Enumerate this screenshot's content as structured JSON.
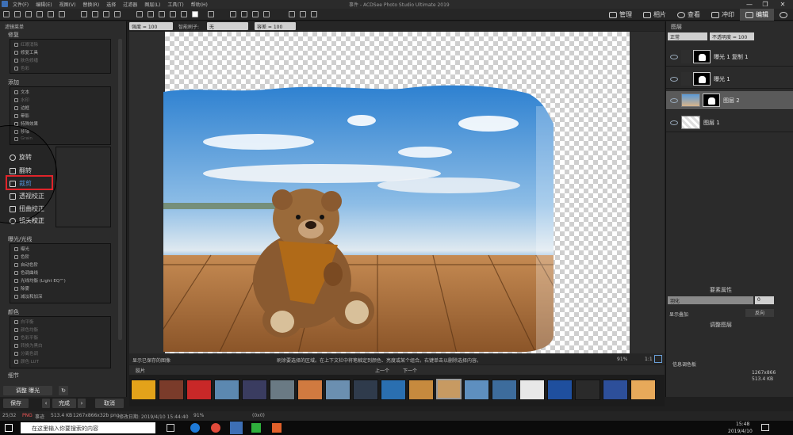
{
  "app": {
    "title": "事件 - ACDSee Photo Studio Ultimate 2019",
    "menus": [
      "文件(F)",
      "编辑(E)",
      "视图(V)",
      "替换(R)",
      "选择",
      "过滤器",
      "图层(L)",
      "工具(T)",
      "帮助(H)"
    ],
    "window_buttons": [
      "—",
      "❐",
      "✕"
    ]
  },
  "modes": [
    {
      "label": "管理",
      "active": false
    },
    {
      "label": "相片",
      "active": false
    },
    {
      "label": "查看",
      "active": false
    },
    {
      "label": "冲印",
      "active": false
    },
    {
      "label": "编辑",
      "active": true
    }
  ],
  "options": {
    "fields": [
      "强度 = 100",
      "智能刷子:",
      "无",
      "容差 = 100"
    ]
  },
  "left_panel": {
    "title": "滤镜菜单",
    "sections": [
      {
        "header": "修复",
        "items": [
          "红眼消除",
          "修复工具",
          "肤色修缮",
          "色彩"
        ]
      },
      {
        "header": "添加",
        "items": [
          "文本",
          "水印",
          "边框",
          "晕影",
          "特殊效果",
          "移轴",
          "Grain"
        ]
      },
      {
        "header": "几何形状",
        "items": [
          "旋转",
          "翻转",
          "裁剪",
          "透视校正",
          "扭曲校正",
          "镜头校正"
        ]
      },
      {
        "header": "曝光/光线",
        "items": [
          "曝光",
          "色阶",
          "自动色阶",
          "色调曲线",
          "光线均衡 (Light EQ™)",
          "除雾",
          "减淡和加深"
        ]
      },
      {
        "header": "颜色",
        "items": [
          "白平衡",
          "颜色均衡",
          "色彩平衡",
          "转换为黑白",
          "分离色调",
          "颜色 LUT"
        ]
      },
      {
        "header": "细节",
        "items": []
      }
    ],
    "adjust_label": "调整 曝光",
    "save_label": "保存",
    "done_label": "完成",
    "cancel_label": "取消"
  },
  "canvas": {
    "status_left": "显示已保存的图像",
    "status_hint": "刷涂要选择的区域。在上下文栏中将笔触定到颜色、亮度或某个组合。右键单击以删除选择内容。",
    "zoom": "91%",
    "ratio": "1:1"
  },
  "filmstrip": {
    "label": "胶片",
    "prev": "上一个",
    "next": "下一个",
    "thumbs": [
      "#e3a21a",
      "#7a3b2a",
      "#c82828",
      "#5c88b0",
      "#3a3c60",
      "#6a7a84",
      "#d07a40",
      "#6b8fb0",
      "#2f3b4c",
      "#2a6fb0",
      "#c68a3e",
      "#c79a62",
      "#5e8fbf",
      "#3d6c9c",
      "#e8e8e8",
      "#1f4f9e",
      "#2a2a2a",
      "#2d4f9a",
      "#e7a95a"
    ]
  },
  "right_panel": {
    "title": "图层",
    "blend": "正常",
    "opacity": "不透明度 = 100",
    "layers": [
      {
        "name": "曝光 1 复制 1",
        "selected": false
      },
      {
        "name": "曝光 1",
        "selected": false
      },
      {
        "name": "图层 2",
        "selected": true
      },
      {
        "name": "图层 1",
        "selected": false
      }
    ],
    "props_title": "要素属性",
    "feather_label": "羽化",
    "feather_value": "0",
    "show_overlay": "显示叠加",
    "invert": "反向",
    "adjust_layers": "调整图层",
    "info_title": "信息调色板",
    "info_value1": "1267x866",
    "info_value2": "513.4 KB"
  },
  "status": {
    "count": "25/32",
    "format": "PNG",
    "name": "事迹",
    "size": "513.4 KB",
    "dims": "1267x866x32b png",
    "modified": "修改日期: 2019/4/10 15:44:40",
    "zoom": "91%",
    "coords": "(0x0)"
  },
  "taskbar": {
    "search_placeholder": "在这里输入你要搜索的内容",
    "time": "15:48",
    "date": "2019/4/10"
  }
}
